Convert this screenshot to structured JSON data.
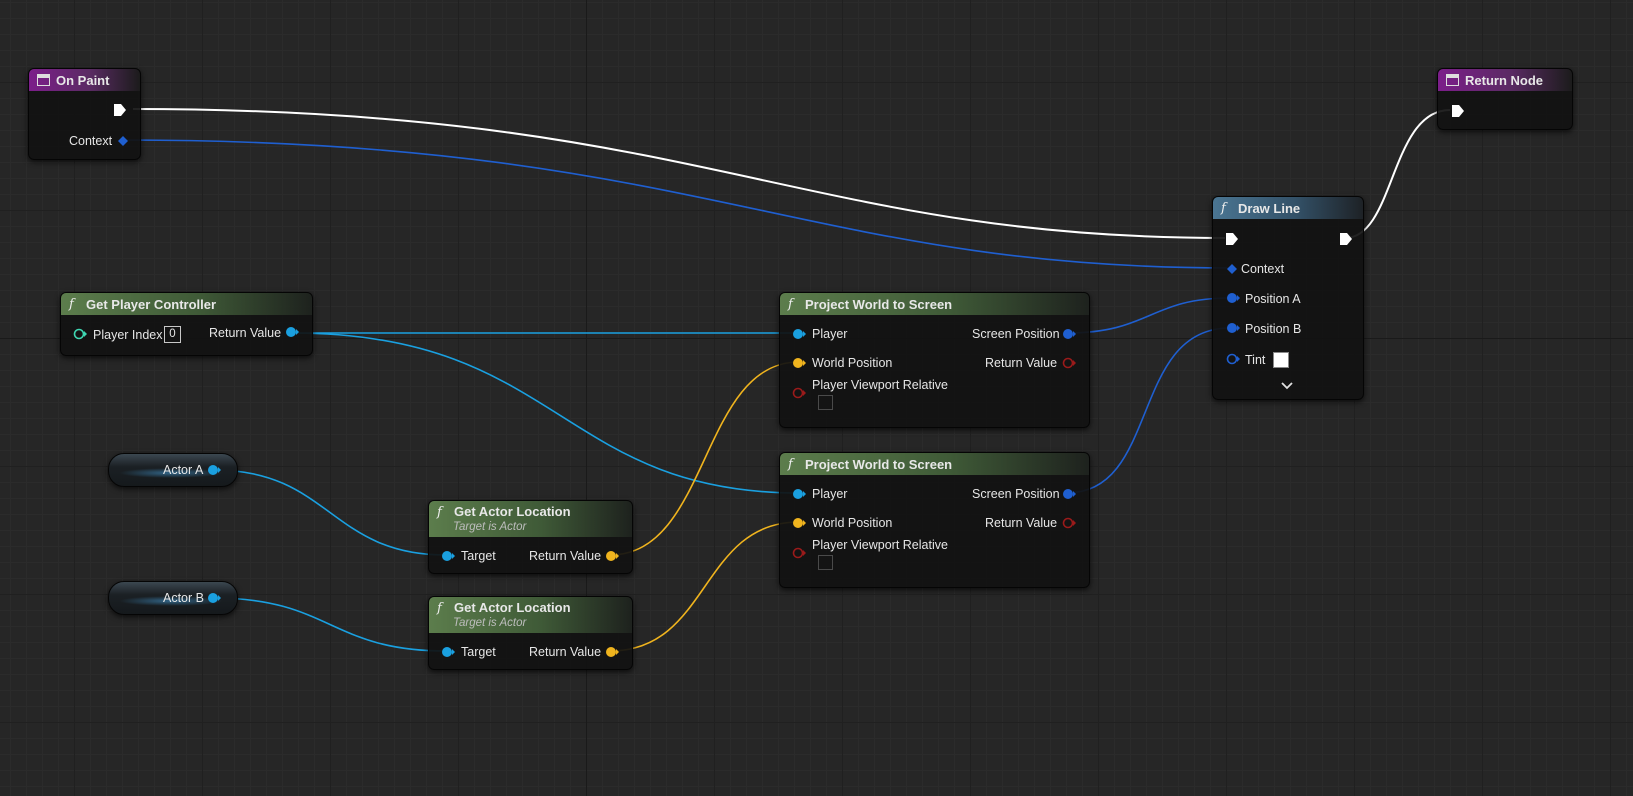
{
  "nodes": {
    "on_paint": {
      "title": "On Paint",
      "context_label": "Context"
    },
    "return_node": {
      "title": "Return Node"
    },
    "draw_line": {
      "title": "Draw Line",
      "context_label": "Context",
      "position_a_label": "Position A",
      "position_b_label": "Position B",
      "tint_label": "Tint",
      "tint_color": "#ffffff"
    },
    "get_player_controller": {
      "title": "Get Player Controller",
      "player_index_label": "Player Index",
      "player_index_value": "0",
      "return_value_label": "Return Value"
    },
    "project_world_1": {
      "title": "Project World to Screen",
      "player_label": "Player",
      "world_position_label": "World Position",
      "viewport_relative_label": "Player Viewport Relative",
      "screen_position_label": "Screen Position",
      "return_value_label": "Return Value"
    },
    "project_world_2": {
      "title": "Project World to Screen",
      "player_label": "Player",
      "world_position_label": "World Position",
      "viewport_relative_label": "Player Viewport Relative",
      "screen_position_label": "Screen Position",
      "return_value_label": "Return Value"
    },
    "actor_a": {
      "label": "Actor A"
    },
    "actor_b": {
      "label": "Actor B"
    },
    "get_actor_location_1": {
      "title": "Get Actor Location",
      "subtitle": "Target is Actor",
      "target_label": "Target",
      "return_value_label": "Return Value"
    },
    "get_actor_location_2": {
      "title": "Get Actor Location",
      "subtitle": "Target is Actor",
      "target_label": "Target",
      "return_value_label": "Return Value"
    }
  },
  "colors": {
    "exec_wire": "#ffffff",
    "context_wire": "#1f5fd0",
    "object_wire": "#1aa0e0",
    "vector_wire": "#f0b41e",
    "vector2d_wire": "#1f5fd0",
    "bool_pin": "#9a1a1a",
    "struct_pin": "#3d9e7f"
  }
}
